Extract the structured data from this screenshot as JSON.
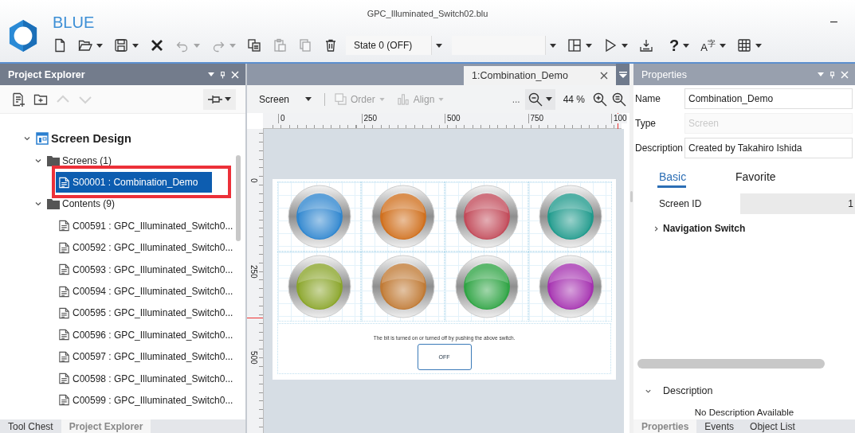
{
  "window": {
    "title": "GPC_Illuminated_Switch02.blu",
    "brand": "BLUE",
    "minimize": "–"
  },
  "toolbar": [
    {
      "kind": "new",
      "disabled": false
    },
    {
      "kind": "open",
      "disabled": false
    },
    {
      "kind": "caret",
      "disabled": false
    },
    {
      "kind": "save",
      "disabled": false
    },
    {
      "kind": "caret",
      "disabled": false
    },
    {
      "kind": "cross",
      "disabled": false
    },
    {
      "kind": "undo",
      "disabled": true
    },
    {
      "kind": "caret",
      "disabled": true
    },
    {
      "kind": "redo",
      "disabled": true
    },
    {
      "kind": "caret",
      "disabled": true
    },
    {
      "kind": "copy",
      "disabled": false
    },
    {
      "kind": "paste",
      "disabled": true
    },
    {
      "kind": "duplicate",
      "disabled": true
    },
    {
      "kind": "trash",
      "disabled": false
    },
    {
      "kind": "combo",
      "value": "State 0 (OFF)"
    },
    {
      "kind": "caret",
      "disabled": false
    },
    {
      "kind": "combo"
    },
    {
      "kind": "caret",
      "disabled": false
    },
    {
      "kind": "layout",
      "disabled": false
    },
    {
      "kind": "caret",
      "disabled": false
    },
    {
      "kind": "play",
      "disabled": false
    },
    {
      "kind": "caret",
      "disabled": false
    },
    {
      "kind": "download",
      "disabled": false
    },
    {
      "kind": "help",
      "glyph": "?",
      "disabled": false
    },
    {
      "kind": "caret",
      "disabled": false
    },
    {
      "kind": "language",
      "glyph": "A$^{字}$",
      "disabled": false
    },
    {
      "kind": "caret",
      "disabled": false
    },
    {
      "kind": "grid",
      "disabled": false
    },
    {
      "kind": "caret",
      "disabled": false
    }
  ],
  "project_explorer": {
    "title": "Project Explorer",
    "tools": [
      {
        "kind": "new-screen",
        "disabled": false
      },
      {
        "kind": "new-folder",
        "disabled": false
      },
      {
        "kind": "up",
        "disabled": true
      },
      {
        "kind": "down",
        "disabled": true
      }
    ],
    "tree": [
      {
        "label": "Screen Design",
        "kind": "root",
        "expanded": true,
        "selected": false,
        "children": [
          {
            "label": "Screens (1)",
            "kind": "folder",
            "expanded": true,
            "selected": false,
            "children": [
              {
                "label": "S00001 : Combination_Demo",
                "selected": true,
                "annotated": true
              }
            ]
          },
          {
            "label": "Contents (9)",
            "kind": "folder",
            "expanded": true,
            "selected": false,
            "children": [
              {
                "label": "C00591 : GPC_Illuminated_Switch0...",
                "selected": false,
                "annotated": false
              },
              {
                "label": "C00592 : GPC_Illuminated_Switch0...",
                "selected": false,
                "annotated": false
              },
              {
                "label": "C00593 : GPC_Illuminated_Switch0...",
                "selected": false,
                "annotated": false
              },
              {
                "label": "C00594 : GPC_Illuminated_Switch0...",
                "selected": false,
                "annotated": false
              },
              {
                "label": "C00595 : GPC_Illuminated_Switch0...",
                "selected": false,
                "annotated": false
              },
              {
                "label": "C00596 : GPC_Illuminated_Switch0...",
                "selected": false,
                "annotated": false
              },
              {
                "label": "C00597 : GPC_Illuminated_Switch0...",
                "selected": false,
                "annotated": false
              },
              {
                "label": "C00598 : GPC_Illuminated_Switch0...",
                "selected": false,
                "annotated": false
              },
              {
                "label": "C00599 : GPC_Illuminated_Switch0...",
                "selected": false,
                "annotated": false
              }
            ]
          }
        ]
      }
    ],
    "bottom_tabs": [
      {
        "label": "Tool Chest",
        "selected": false
      },
      {
        "label": "Project Explorer",
        "selected": true
      }
    ]
  },
  "editor": {
    "tab": "1:Combination_Demo",
    "toolbar": {
      "mode": "Screen",
      "order": {
        "label": "Order",
        "disabled": true
      },
      "align": {
        "label": "Align",
        "disabled": true
      },
      "more": "...",
      "zoom": "44 %"
    },
    "ruler": {
      "x_labels": [
        "0",
        "250",
        "500",
        "750",
        "100"
      ],
      "y_labels": [
        "0",
        "250",
        "500"
      ]
    },
    "screen": {
      "switches": [
        {
          "color": "#2f86cf"
        },
        {
          "color": "#d0701e"
        },
        {
          "color": "#c24b5a"
        },
        {
          "color": "#1f9a8c"
        },
        {
          "color": "#8aa52a"
        },
        {
          "color": "#c07a35"
        },
        {
          "color": "#2fa444"
        },
        {
          "color": "#a531b0"
        }
      ],
      "caption": "The bit is turned on or turned off by pushing the above switch.",
      "button": "OFF"
    }
  },
  "properties": {
    "title": "Properties",
    "fields": [
      {
        "label": "Name",
        "value": "Combination_Demo",
        "disabled": false
      },
      {
        "label": "Type",
        "value": "Screen",
        "disabled": true
      },
      {
        "label": "Description",
        "value": "Created by Takahiro Ishida",
        "disabled": false
      }
    ],
    "tabs": [
      {
        "label": "Basic",
        "selected": true
      },
      {
        "label": "Favorite",
        "selected": false
      }
    ],
    "screen_id": {
      "label": "Screen ID",
      "value": "1"
    },
    "group": {
      "label": "Navigation Switch",
      "expanded": false
    },
    "description": {
      "label": "Description",
      "expanded": true,
      "text": "No Description Available"
    },
    "bottom_tabs": [
      {
        "label": "Properties",
        "selected": true
      },
      {
        "label": "Events",
        "selected": false
      },
      {
        "label": "Object List",
        "selected": false
      }
    ]
  }
}
